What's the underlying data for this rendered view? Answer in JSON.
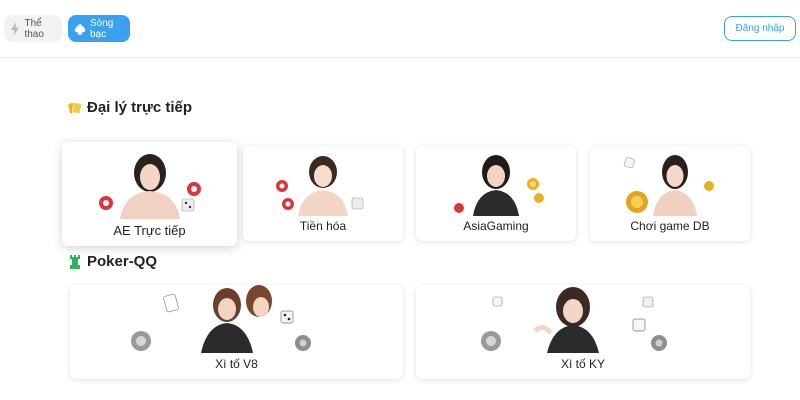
{
  "header": {
    "tabs": [
      {
        "label": "Thể thao",
        "icon": "lightning-icon"
      },
      {
        "label": "Sòng bạc",
        "icon": "spade-icon",
        "active": true
      }
    ],
    "login_label": "Đăng nhập"
  },
  "colors": {
    "accent": "#3aa0f0",
    "tab_inactive_bg": "#f2f2f2",
    "crown_icon": "#f0b400",
    "rook_icon": "#2db35a"
  },
  "sections": [
    {
      "title": "Đại lý trực tiếp",
      "icon": "crown-icon",
      "cards": [
        {
          "label": "AE Trực tiếp",
          "active": true
        },
        {
          "label": "Tiền hóa"
        },
        {
          "label": "AsiaGaming"
        },
        {
          "label": "Chơi game DB"
        }
      ]
    },
    {
      "title": "Poker-QQ",
      "icon": "rook-icon",
      "cards": [
        {
          "label": "Xì tố V8"
        },
        {
          "label": "Xì tố KY"
        }
      ]
    }
  ]
}
